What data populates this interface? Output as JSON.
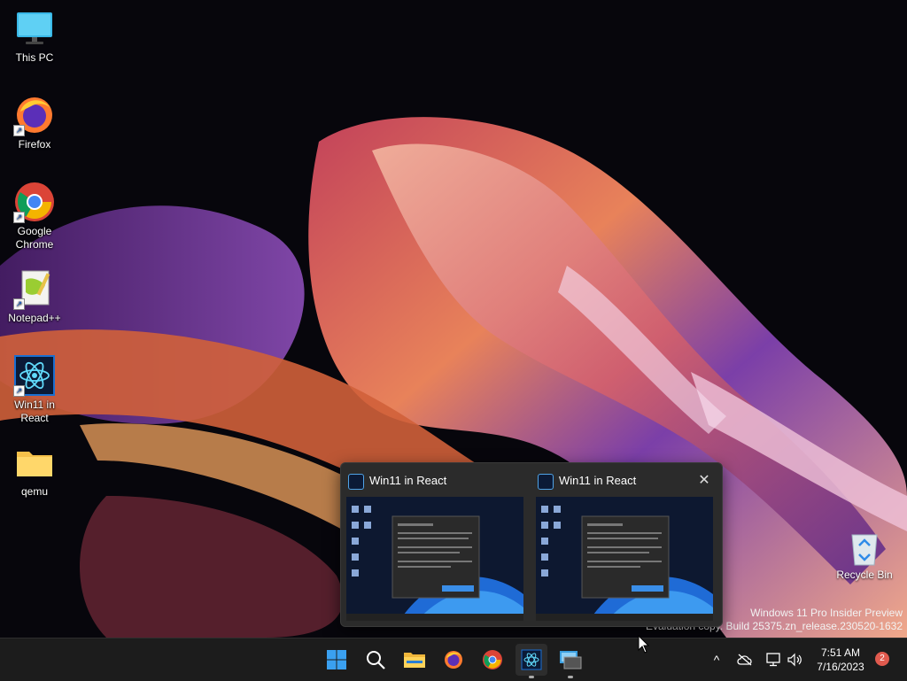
{
  "desktop": {
    "icons": [
      {
        "label": "This PC",
        "icon": "monitor-icon"
      },
      {
        "label": "Firefox",
        "icon": "firefox-icon"
      },
      {
        "label": "Google Chrome",
        "icon": "chrome-icon"
      },
      {
        "label": "Notepad++",
        "icon": "notepadpp-icon"
      },
      {
        "label": "Win11 in React",
        "icon": "react-icon"
      },
      {
        "label": "qemu",
        "icon": "folder-icon"
      }
    ],
    "recycle_bin": {
      "label": "Recycle Bin",
      "icon": "recycle-bin-icon"
    }
  },
  "watermark": {
    "line1": "Windows 11 Pro Insider Preview",
    "line2": "Evaluation copy. Build 25375.zn_release.230520-1632"
  },
  "preview": {
    "windows": [
      {
        "title": "Win11 in React"
      },
      {
        "title": "Win11 in React"
      }
    ],
    "close_glyph": "✕"
  },
  "taskbar": {
    "apps": [
      {
        "icon": "windows-start-icon"
      },
      {
        "icon": "search-icon"
      },
      {
        "icon": "file-explorer-icon"
      },
      {
        "icon": "firefox-icon"
      },
      {
        "icon": "chrome-icon"
      },
      {
        "icon": "win11-react-icon",
        "active": true
      },
      {
        "icon": "remote-desktop-icon",
        "active": true
      }
    ],
    "tray": {
      "chevron": "^",
      "icons": [
        "onedrive-icon",
        "network-icon",
        "volume-icon"
      ]
    },
    "clock": {
      "time": "7:51 AM",
      "date": "7/16/2023"
    },
    "notification_count": "2"
  },
  "colors": {
    "taskbar_bg": "#1c1c1c",
    "accent": "#0078d4",
    "badge": "#e05a4e"
  }
}
